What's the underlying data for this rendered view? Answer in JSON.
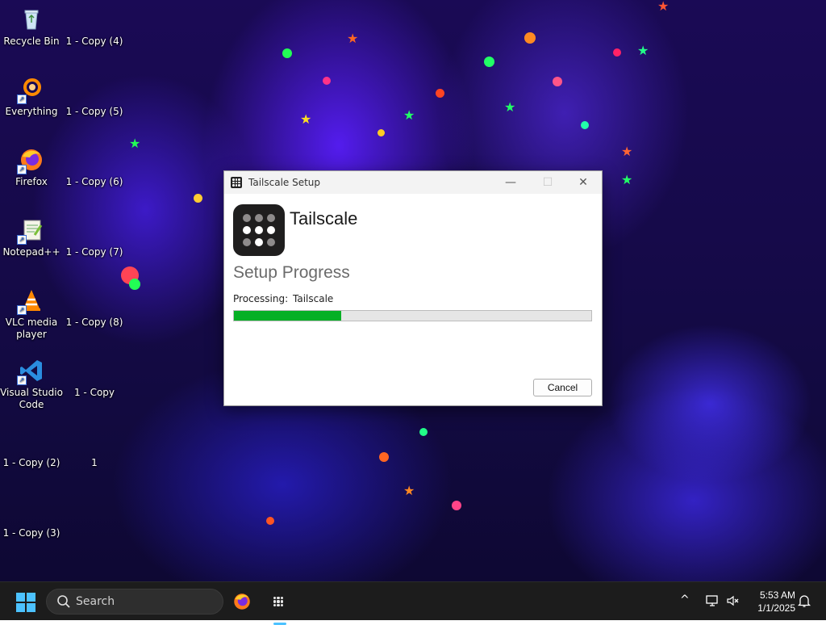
{
  "desktop": {
    "icons": [
      {
        "label": "Recycle Bin",
        "icon": "recycle-bin-icon"
      },
      {
        "label": "1 - Copy (4)",
        "icon": "file-icon"
      },
      {
        "label": "Everything",
        "icon": "everything-search-icon"
      },
      {
        "label": "1 - Copy (5)",
        "icon": "file-icon"
      },
      {
        "label": "Firefox",
        "icon": "firefox-icon"
      },
      {
        "label": "1 - Copy (6)",
        "icon": "file-icon"
      },
      {
        "label": "Notepad++",
        "icon": "notepadpp-icon"
      },
      {
        "label": "1 - Copy (7)",
        "icon": "file-icon"
      },
      {
        "label": "VLC media player",
        "icon": "vlc-icon"
      },
      {
        "label": "1 - Copy (8)",
        "icon": "file-icon"
      },
      {
        "label": "Visual Studio Code",
        "icon": "vscode-icon"
      },
      {
        "label": "1 - Copy",
        "icon": "file-icon"
      },
      {
        "label": "1 - Copy (2)",
        "icon": "file-icon"
      },
      {
        "label": "1",
        "icon": "file-icon"
      },
      {
        "label": "1 - Copy (3)",
        "icon": "file-icon"
      }
    ]
  },
  "window": {
    "title": "Tailscale Setup",
    "brand_name": "Tailscale",
    "heading": "Setup Progress",
    "processing_label": "Processing:",
    "processing_value": "Tailscale",
    "progress_percent": 30,
    "cancel_label": "Cancel",
    "min_glyph": "—",
    "max_glyph": "☐",
    "close_glyph": "✕"
  },
  "taskbar": {
    "search_placeholder": "Search",
    "time": "5:53 AM",
    "date": "1/1/2025",
    "chevron_glyph": "^"
  },
  "colors": {
    "progress_fill": "#06b025",
    "accent": "#4cc2ff",
    "taskbar_bg": "#1c1c1c"
  }
}
